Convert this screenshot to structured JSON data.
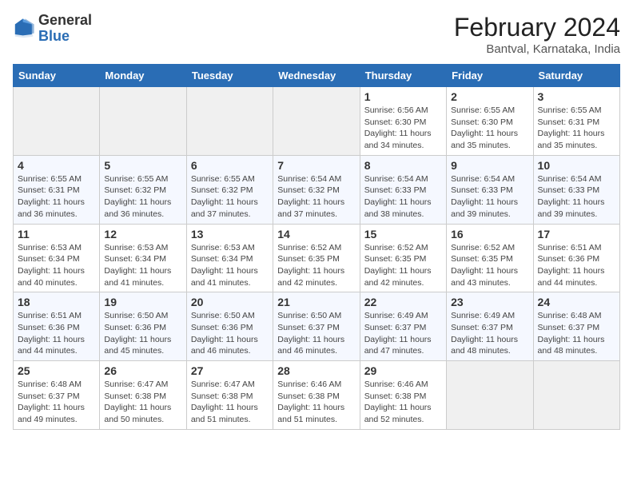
{
  "header": {
    "logo_general": "General",
    "logo_blue": "Blue",
    "month_year": "February 2024",
    "location": "Bantval, Karnataka, India"
  },
  "weekdays": [
    "Sunday",
    "Monday",
    "Tuesday",
    "Wednesday",
    "Thursday",
    "Friday",
    "Saturday"
  ],
  "weeks": [
    [
      {
        "day": "",
        "sunrise": "",
        "sunset": "",
        "daylight": ""
      },
      {
        "day": "",
        "sunrise": "",
        "sunset": "",
        "daylight": ""
      },
      {
        "day": "",
        "sunrise": "",
        "sunset": "",
        "daylight": ""
      },
      {
        "day": "",
        "sunrise": "",
        "sunset": "",
        "daylight": ""
      },
      {
        "day": "1",
        "sunrise": "Sunrise: 6:56 AM",
        "sunset": "Sunset: 6:30 PM",
        "daylight": "Daylight: 11 hours and 34 minutes."
      },
      {
        "day": "2",
        "sunrise": "Sunrise: 6:55 AM",
        "sunset": "Sunset: 6:30 PM",
        "daylight": "Daylight: 11 hours and 35 minutes."
      },
      {
        "day": "3",
        "sunrise": "Sunrise: 6:55 AM",
        "sunset": "Sunset: 6:31 PM",
        "daylight": "Daylight: 11 hours and 35 minutes."
      }
    ],
    [
      {
        "day": "4",
        "sunrise": "Sunrise: 6:55 AM",
        "sunset": "Sunset: 6:31 PM",
        "daylight": "Daylight: 11 hours and 36 minutes."
      },
      {
        "day": "5",
        "sunrise": "Sunrise: 6:55 AM",
        "sunset": "Sunset: 6:32 PM",
        "daylight": "Daylight: 11 hours and 36 minutes."
      },
      {
        "day": "6",
        "sunrise": "Sunrise: 6:55 AM",
        "sunset": "Sunset: 6:32 PM",
        "daylight": "Daylight: 11 hours and 37 minutes."
      },
      {
        "day": "7",
        "sunrise": "Sunrise: 6:54 AM",
        "sunset": "Sunset: 6:32 PM",
        "daylight": "Daylight: 11 hours and 37 minutes."
      },
      {
        "day": "8",
        "sunrise": "Sunrise: 6:54 AM",
        "sunset": "Sunset: 6:33 PM",
        "daylight": "Daylight: 11 hours and 38 minutes."
      },
      {
        "day": "9",
        "sunrise": "Sunrise: 6:54 AM",
        "sunset": "Sunset: 6:33 PM",
        "daylight": "Daylight: 11 hours and 39 minutes."
      },
      {
        "day": "10",
        "sunrise": "Sunrise: 6:54 AM",
        "sunset": "Sunset: 6:33 PM",
        "daylight": "Daylight: 11 hours and 39 minutes."
      }
    ],
    [
      {
        "day": "11",
        "sunrise": "Sunrise: 6:53 AM",
        "sunset": "Sunset: 6:34 PM",
        "daylight": "Daylight: 11 hours and 40 minutes."
      },
      {
        "day": "12",
        "sunrise": "Sunrise: 6:53 AM",
        "sunset": "Sunset: 6:34 PM",
        "daylight": "Daylight: 11 hours and 41 minutes."
      },
      {
        "day": "13",
        "sunrise": "Sunrise: 6:53 AM",
        "sunset": "Sunset: 6:34 PM",
        "daylight": "Daylight: 11 hours and 41 minutes."
      },
      {
        "day": "14",
        "sunrise": "Sunrise: 6:52 AM",
        "sunset": "Sunset: 6:35 PM",
        "daylight": "Daylight: 11 hours and 42 minutes."
      },
      {
        "day": "15",
        "sunrise": "Sunrise: 6:52 AM",
        "sunset": "Sunset: 6:35 PM",
        "daylight": "Daylight: 11 hours and 42 minutes."
      },
      {
        "day": "16",
        "sunrise": "Sunrise: 6:52 AM",
        "sunset": "Sunset: 6:35 PM",
        "daylight": "Daylight: 11 hours and 43 minutes."
      },
      {
        "day": "17",
        "sunrise": "Sunrise: 6:51 AM",
        "sunset": "Sunset: 6:36 PM",
        "daylight": "Daylight: 11 hours and 44 minutes."
      }
    ],
    [
      {
        "day": "18",
        "sunrise": "Sunrise: 6:51 AM",
        "sunset": "Sunset: 6:36 PM",
        "daylight": "Daylight: 11 hours and 44 minutes."
      },
      {
        "day": "19",
        "sunrise": "Sunrise: 6:50 AM",
        "sunset": "Sunset: 6:36 PM",
        "daylight": "Daylight: 11 hours and 45 minutes."
      },
      {
        "day": "20",
        "sunrise": "Sunrise: 6:50 AM",
        "sunset": "Sunset: 6:36 PM",
        "daylight": "Daylight: 11 hours and 46 minutes."
      },
      {
        "day": "21",
        "sunrise": "Sunrise: 6:50 AM",
        "sunset": "Sunset: 6:37 PM",
        "daylight": "Daylight: 11 hours and 46 minutes."
      },
      {
        "day": "22",
        "sunrise": "Sunrise: 6:49 AM",
        "sunset": "Sunset: 6:37 PM",
        "daylight": "Daylight: 11 hours and 47 minutes."
      },
      {
        "day": "23",
        "sunrise": "Sunrise: 6:49 AM",
        "sunset": "Sunset: 6:37 PM",
        "daylight": "Daylight: 11 hours and 48 minutes."
      },
      {
        "day": "24",
        "sunrise": "Sunrise: 6:48 AM",
        "sunset": "Sunset: 6:37 PM",
        "daylight": "Daylight: 11 hours and 48 minutes."
      }
    ],
    [
      {
        "day": "25",
        "sunrise": "Sunrise: 6:48 AM",
        "sunset": "Sunset: 6:37 PM",
        "daylight": "Daylight: 11 hours and 49 minutes."
      },
      {
        "day": "26",
        "sunrise": "Sunrise: 6:47 AM",
        "sunset": "Sunset: 6:38 PM",
        "daylight": "Daylight: 11 hours and 50 minutes."
      },
      {
        "day": "27",
        "sunrise": "Sunrise: 6:47 AM",
        "sunset": "Sunset: 6:38 PM",
        "daylight": "Daylight: 11 hours and 51 minutes."
      },
      {
        "day": "28",
        "sunrise": "Sunrise: 6:46 AM",
        "sunset": "Sunset: 6:38 PM",
        "daylight": "Daylight: 11 hours and 51 minutes."
      },
      {
        "day": "29",
        "sunrise": "Sunrise: 6:46 AM",
        "sunset": "Sunset: 6:38 PM",
        "daylight": "Daylight: 11 hours and 52 minutes."
      },
      {
        "day": "",
        "sunrise": "",
        "sunset": "",
        "daylight": ""
      },
      {
        "day": "",
        "sunrise": "",
        "sunset": "",
        "daylight": ""
      }
    ]
  ]
}
